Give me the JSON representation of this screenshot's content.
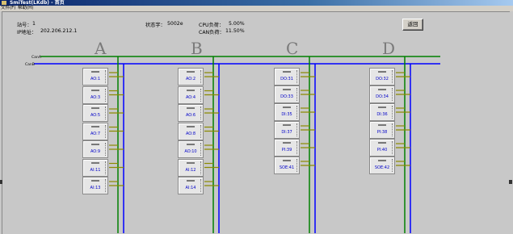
{
  "window": {
    "title": "SmiTest(LKdb) - 首页"
  },
  "menu": [
    {
      "label": "文件(F)"
    },
    {
      "label": "帮助(H)"
    }
  ],
  "info": {
    "station_label": "站号：",
    "station_value": "1",
    "ip_label": "IP地址：",
    "ip_value": "202.206.212.1",
    "status_label": "状态字：",
    "status_value": "5002e",
    "cpu_label": "CPU负荷：",
    "cpu_value": "5.00%",
    "can_label": "CAN负荷：",
    "can_value": "11.50%"
  },
  "return_button": "返回",
  "buses": {
    "cana": "CanA",
    "canb": "CanB",
    "cana_color": "#008000",
    "canb_color": "#0000ff"
  },
  "segments": [
    {
      "name": "A",
      "cards": [
        "AO:1",
        "AO:3",
        "AO:5",
        "AO:7",
        "AO:9",
        "AI:11",
        "AI:13"
      ]
    },
    {
      "name": "B",
      "cards": [
        "AO:2",
        "AO:4",
        "AO:6",
        "AO:8",
        "AO:10",
        "AI:12",
        "AI:14"
      ]
    },
    {
      "name": "C",
      "cards": [
        "DO:31",
        "DO:33",
        "DI:35",
        "DI:37",
        "PI:39",
        "SOE:41"
      ]
    },
    {
      "name": "D",
      "cards": [
        "DO:32",
        "DO:34",
        "DI:36",
        "PI:38",
        "PI:40",
        "SOE:42"
      ]
    }
  ]
}
